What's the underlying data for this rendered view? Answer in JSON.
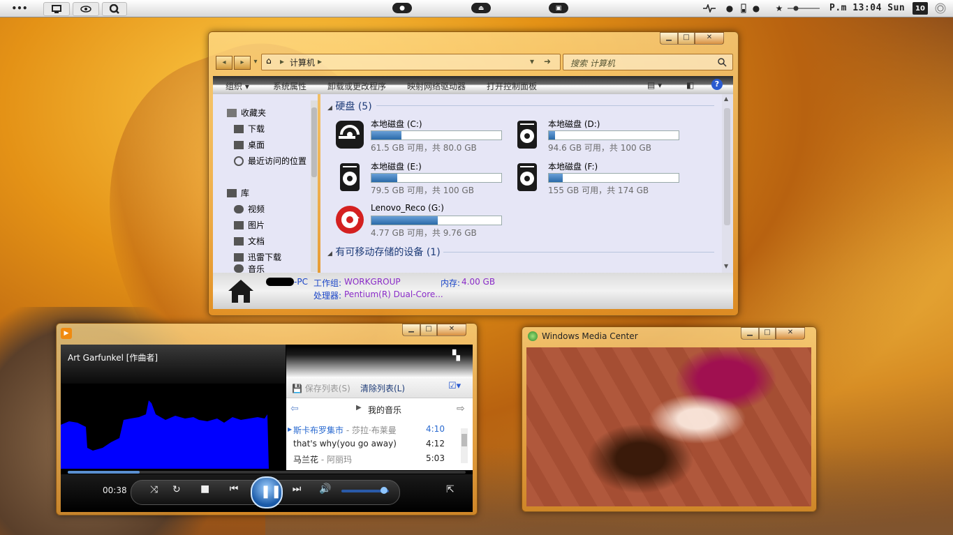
{
  "topbar": {
    "menu_dots": "•••",
    "clock": "P.m 13:04 Sun",
    "date_badge": "10",
    "center_pills": [
      "●",
      "⏏",
      "▣"
    ]
  },
  "explorer": {
    "address": "计算机",
    "search_placeholder": "搜索 计算机",
    "commands": [
      "组织 ▾",
      "系统属性",
      "卸载或更改程序",
      "映射网络驱动器",
      "打开控制面板"
    ],
    "nav": {
      "favorites_title": "收藏夹",
      "favorites": [
        "下载",
        "桌面",
        "最近访问的位置"
      ],
      "libraries_title": "库",
      "libraries": [
        "视频",
        "图片",
        "文档",
        "迅雷下载",
        "音乐"
      ]
    },
    "group_hdd": "硬盘 (5)",
    "group_removable": "有可移动存储的设备 (1)",
    "drives": [
      {
        "name": "本地磁盘 (C:)",
        "cap": "61.5 GB 可用，共 80.0 GB",
        "used": 0.23
      },
      {
        "name": "本地磁盘 (D:)",
        "cap": "94.6 GB 可用，共 100 GB",
        "used": 0.05
      },
      {
        "name": "本地磁盘 (E:)",
        "cap": "79.5 GB 可用，共 100 GB",
        "used": 0.2
      },
      {
        "name": "本地磁盘 (F:)",
        "cap": "155 GB 可用，共 174 GB",
        "used": 0.11
      },
      {
        "name": "Lenovo_Reco (G:)",
        "cap": "4.77 GB 可用，共 9.76 GB",
        "used": 0.51
      }
    ],
    "details": {
      "pc_name": "-PC",
      "workgroup_label": "工作组:",
      "workgroup": "WORKGROUP",
      "memory_label": "内存:",
      "memory": "4.00 GB",
      "cpu_label": "处理器:",
      "cpu": "Pentium(R) Dual-Core..."
    }
  },
  "wmp": {
    "now_playing": "Art Garfunkel [作曲者]",
    "save_list": "保存列表(S)",
    "clear_list": "清除列表(L)",
    "library_title": "我的音乐",
    "tracks": [
      {
        "title": "斯卡布罗集市",
        "artist": "- 莎拉·布莱曼",
        "dur": "4:10"
      },
      {
        "title": "that's why(you go away)",
        "artist": "",
        "dur": "4:12"
      },
      {
        "title": "马兰花",
        "artist": "- 阿丽玛",
        "dur": "5:03"
      }
    ],
    "time": "00:38",
    "progress": 0.18,
    "volume": 0.8
  },
  "wmc": {
    "title": "Windows Media Center"
  },
  "colors": {
    "accent_orange": "#e49216",
    "link_blue": "#1a45c8",
    "value_purple": "#8a2cc8",
    "viz_blue": "#0000ff"
  }
}
